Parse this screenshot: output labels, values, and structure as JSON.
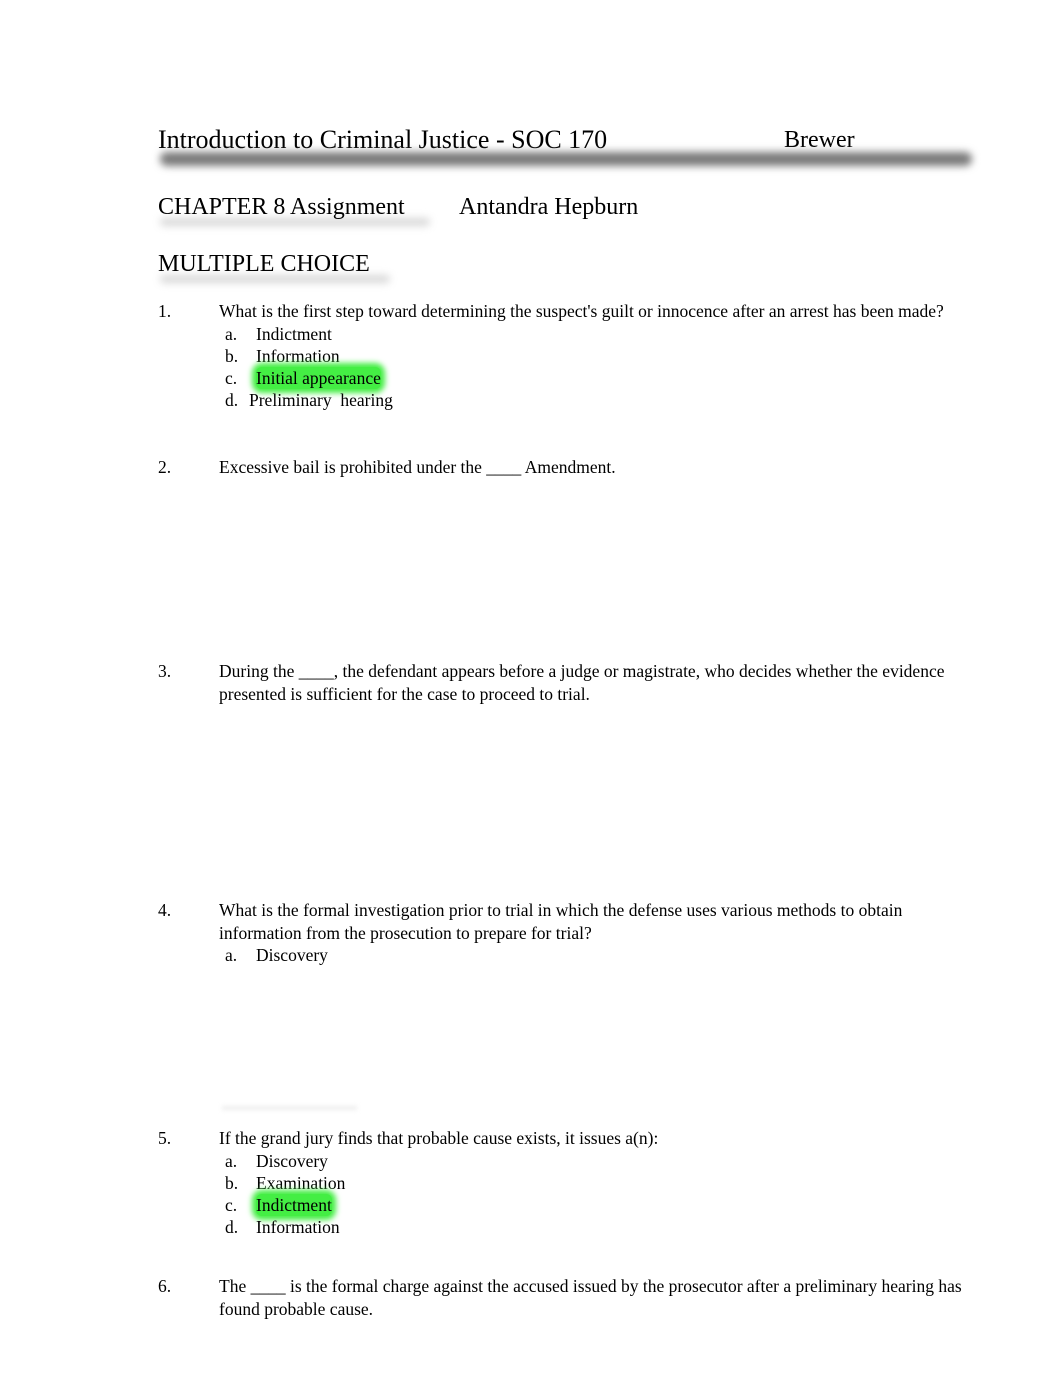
{
  "header": {
    "course_title": "Introduction to Criminal Justice - SOC 170",
    "instructor": "Brewer",
    "assignment": "CHAPTER 8 Assignment",
    "student_name": "Antandra Hepburn",
    "section_title": "MULTIPLE CHOICE"
  },
  "highlight_color": "#44ee44",
  "questions": [
    {
      "number": "1.",
      "text": "What is the first step toward determining the suspect's guilt or innocence after an arrest has been made?",
      "options": [
        {
          "letter": "a.",
          "label": "Indictment",
          "highlighted": false
        },
        {
          "letter": "b.",
          "label": "Information",
          "highlighted": false
        },
        {
          "letter": "c.",
          "label": "Initial appearance",
          "highlighted": true
        },
        {
          "letter": "d.",
          "label": "Preliminary  hearing",
          "highlighted": false
        }
      ]
    },
    {
      "number": "2.",
      "text": "Excessive bail is prohibited under the ____ Amendment.",
      "options": []
    },
    {
      "number": "3.",
      "text": "During the ____, the defendant appears before a judge or magistrate, who decides whether the evidence presented is sufficient for the case to proceed to trial.",
      "options": []
    },
    {
      "number": "4.",
      "text": "What is the formal investigation prior to trial in which the defense uses various methods to obtain information from the prosecution to prepare for trial?",
      "options": [
        {
          "letter": "a.",
          "label": "Discovery",
          "highlighted": false
        }
      ]
    },
    {
      "number": "5.",
      "text": "If the grand jury finds that probable cause exists, it issues a(n):",
      "options": [
        {
          "letter": "a.",
          "label": "Discovery",
          "highlighted": false
        },
        {
          "letter": "b.",
          "label": "Examination",
          "highlighted": false
        },
        {
          "letter": "c.",
          "label": "Indictment",
          "highlighted": true
        },
        {
          "letter": "d.",
          "label": "Information",
          "highlighted": false
        }
      ]
    },
    {
      "number": "6.",
      "text": "The ____ is the formal charge against the accused issued by the prosecutor after a preliminary hearing has found probable cause.",
      "options": []
    }
  ]
}
